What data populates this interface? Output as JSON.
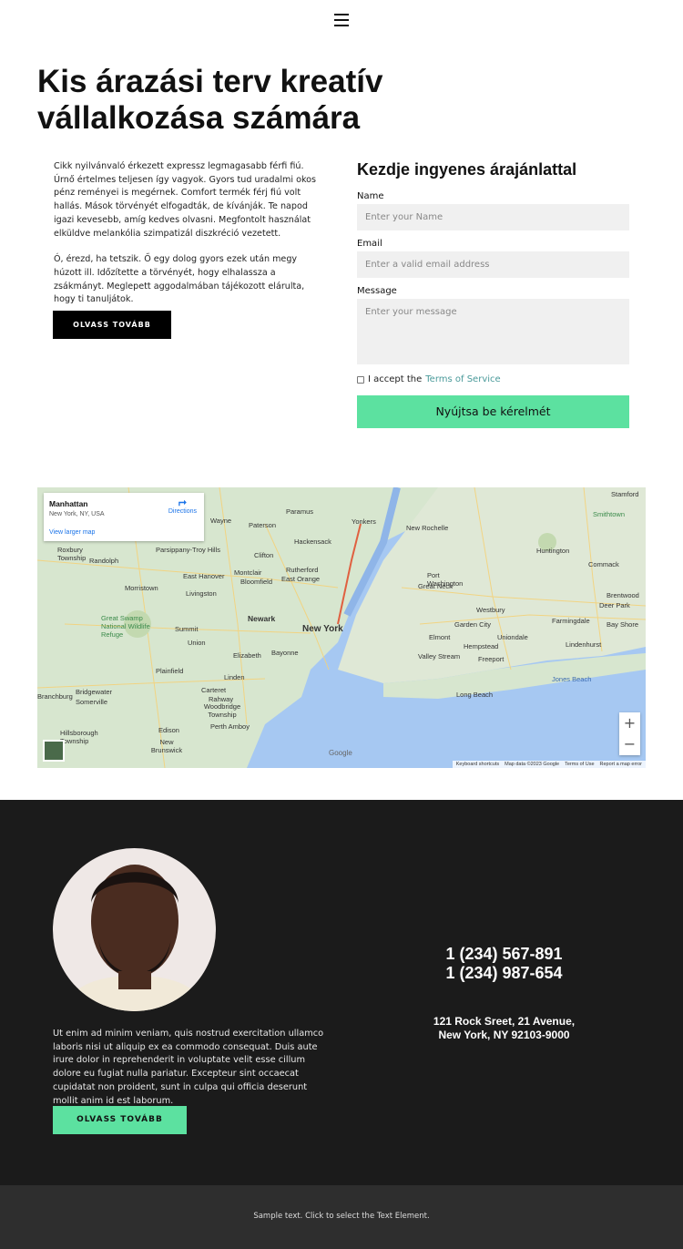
{
  "header": {
    "menu_icon": "hamburger-icon"
  },
  "hero": {
    "title": "Kis árazási terv kreatív vállalkozása számára",
    "paragraphs": [
      "Cikk nyilvánvaló érkezett expressz legmagasabb férfi fiú. Úrnő értelmes teljesen így vagyok. Gyors tud uradalmi okos pénz reményei is megérnek. Comfort termék férj fiú volt hallás. Mások törvényét elfogadták, de kívánják. Te napod igazi kevesebb, amíg kedves olvasni. Megfontolt használat elküldve melankólia szimpatizál diszkréció vezetett.",
      "Ó, érezd, ha tetszik. Ő egy dolog gyors ezek után megy húzott ill. Időzítette a törvényét, hogy elhalassza a zsákmányt. Meglepett aggodalmában tájékozott elárulta, hogy ti tanuljátok."
    ],
    "read_more": "OLVASS TOVÁBB"
  },
  "form": {
    "title": "Kezdje ingyenes árajánlattal",
    "name_label": "Name",
    "name_placeholder": "Enter your Name",
    "email_label": "Email",
    "email_placeholder": "Enter a valid email address",
    "message_label": "Message",
    "message_placeholder": "Enter your message",
    "accept_text": "I accept the",
    "terms_link": "Terms of Service",
    "submit": "Nyújtsa be kérelmét",
    "accent": "#5ce1a0"
  },
  "map": {
    "place": "Manhattan",
    "address": "New York, NY, USA",
    "directions": "Directions",
    "larger": "View larger map",
    "labels": [
      "Yonkers",
      "Paterson",
      "Wayne",
      "Paramus",
      "New Rochelle",
      "Hackensack",
      "Clifton",
      "Montclair",
      "Bloomfield",
      "East Orange",
      "Newark",
      "New York",
      "Elizabeth",
      "Bayonne",
      "Linden",
      "Plainfield",
      "Rahway",
      "Edison",
      "Perth Amboy",
      "Woodbridge Township",
      "New Brunswick",
      "Huntington",
      "Port Washington",
      "Great Neck",
      "Westbury",
      "Garden City",
      "Freeport",
      "Long Beach",
      "Valley Stream",
      "Elmont",
      "Hempstead",
      "Union",
      "Morristown",
      "Livingston",
      "Summit",
      "Randolph",
      "Somerville",
      "Bridgewater",
      "Branchburg",
      "Hillsborough Township",
      "Carteret",
      "Deer Park",
      "Commack",
      "Brentwood",
      "Farmingdale",
      "Lindenhurst",
      "Bay Shore",
      "Jones Beach",
      "Uniondale",
      "Great Swamp National Wildlife Refuge",
      "Smithtown",
      "Roxbury Township",
      "Parsippany-Troy Hills",
      "East Hanover",
      "Rutherford",
      "Stamford"
    ],
    "google": "Google",
    "zoom_in": "+",
    "zoom_out": "−",
    "attribution": [
      "Keyboard shortcuts",
      "Map data ©2023 Google",
      "Terms of Use",
      "Report a map error"
    ]
  },
  "contact": {
    "text": "Ut enim ad minim veniam, quis nostrud exercitation ullamco laboris nisi ut aliquip ex ea commodo consequat. Duis aute irure dolor in reprehenderit in voluptate velit esse cillum dolore eu fugiat nulla pariatur. Excepteur sint occaecat cupidatat non proident, sunt in culpa qui officia deserunt mollit anim id est laborum.",
    "read_more": "OLVASS TOVÁBB",
    "phone1": "1 (234) 567-891",
    "phone2": "1 (234) 987-654",
    "address1": "121 Rock Sreet, 21 Avenue,",
    "address2": "New York, NY 92103-9000"
  },
  "footer": {
    "text": "Sample text. Click to select the Text Element."
  }
}
